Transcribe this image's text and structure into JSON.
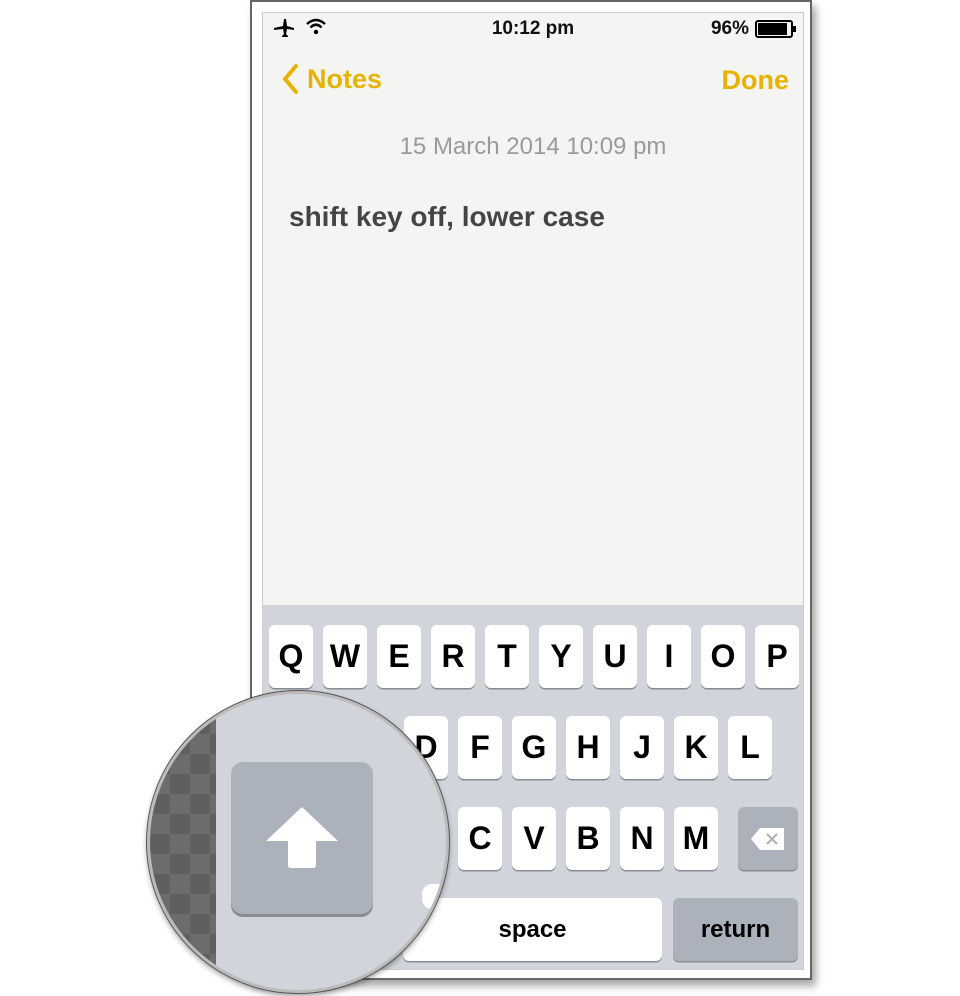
{
  "status_bar": {
    "time": "10:12 pm",
    "battery_percent": "96%",
    "battery_level": 0.96,
    "icons": [
      "airplane-icon",
      "wifi-icon",
      "battery-icon"
    ]
  },
  "nav": {
    "back_label": "Notes",
    "done_label": "Done",
    "accent": "#e6b400"
  },
  "note": {
    "date": "15 March 2014 10:09 pm",
    "text": "shift key off, lower case"
  },
  "keyboard": {
    "row1": [
      "Q",
      "W",
      "E",
      "R",
      "T",
      "Y",
      "U",
      "I",
      "O",
      "P"
    ],
    "row2": [
      "D",
      "F",
      "G",
      "H",
      "J",
      "K",
      "L"
    ],
    "row3": [
      "C",
      "V",
      "B",
      "N",
      "M"
    ],
    "space_label": "space",
    "return_label": "return",
    "shift_state": "off"
  }
}
